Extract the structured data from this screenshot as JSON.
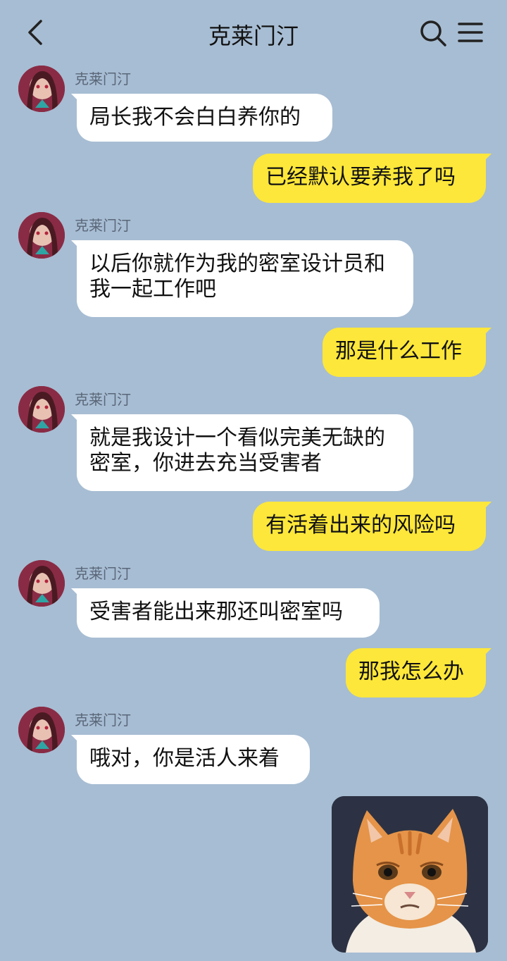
{
  "header": {
    "title": "克莱门汀"
  },
  "contact": {
    "name": "克莱门汀"
  },
  "messages": [
    {
      "from": "contact",
      "text": "局长我不会白白养你的"
    },
    {
      "from": "me",
      "text": "已经默认要养我了吗"
    },
    {
      "from": "contact",
      "text": "以后你就作为我的密室设计员和我一起工作吧"
    },
    {
      "from": "me",
      "text": "那是什么工作"
    },
    {
      "from": "contact",
      "text": "就是我设计一个看似完美无缺的密室，你进去充当受害者"
    },
    {
      "from": "me",
      "text": "有活着出来的风险吗"
    },
    {
      "from": "contact",
      "text": "受害者能出来那还叫密室吗"
    },
    {
      "from": "me",
      "text": "那我怎么办"
    },
    {
      "from": "contact",
      "text": "哦对，你是活人来着"
    },
    {
      "from": "me",
      "type": "sticker",
      "sticker": "sad-cat-sticker"
    }
  ],
  "icons": {
    "back": "back-arrow-icon",
    "search": "search-icon",
    "menu": "menu-icon"
  },
  "colors": {
    "background": "#a7bdd3",
    "incoming_bubble": "#ffffff",
    "outgoing_bubble": "#fde73a"
  }
}
